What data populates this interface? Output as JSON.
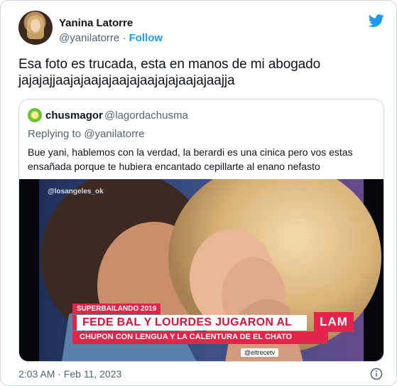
{
  "author": {
    "name": "Yanina Latorre",
    "handle": "@yanilatorre",
    "separator": "·",
    "follow_label": "Follow"
  },
  "tweet": {
    "text_line1": "Esa foto es trucada, esta en manos de mi abogado",
    "text_line2": "jajajajjaajajaajajaajajaajajajaajajaajja"
  },
  "quoted": {
    "name": "chusmagor",
    "handle": "@lagordachusma",
    "replying_to": "Replying to @yanilatorre",
    "text_line1": "Bue yani, hablemos con la verdad, la berardi es una cinica pero vos estas",
    "text_line2": "ensañada porque te hubiera encantado cepillarte al enano nefasto",
    "media": {
      "watermark": "@losangeles_ok",
      "lower_third_top": "SUPERBAILANDO 2019",
      "lower_third_main": "FEDE BAL Y LOURDES JUGARON AL LIMITE",
      "lower_third_sub": "CHUPON CON LENGUA Y LA CALENTURA DE EL CHATO",
      "channel_logo": "LAM",
      "network_tag": "@eltrecetv"
    }
  },
  "footer": {
    "timestamp": "2:03 AM · Feb 11, 2023"
  },
  "icons": {
    "brand": "twitter-bird-icon",
    "info": "info-icon"
  },
  "colors": {
    "accent": "#1d9bf0",
    "text": "#0f1419",
    "muted": "#536471",
    "border": "#cfd9de",
    "broadcast_red": "#e5244b"
  }
}
